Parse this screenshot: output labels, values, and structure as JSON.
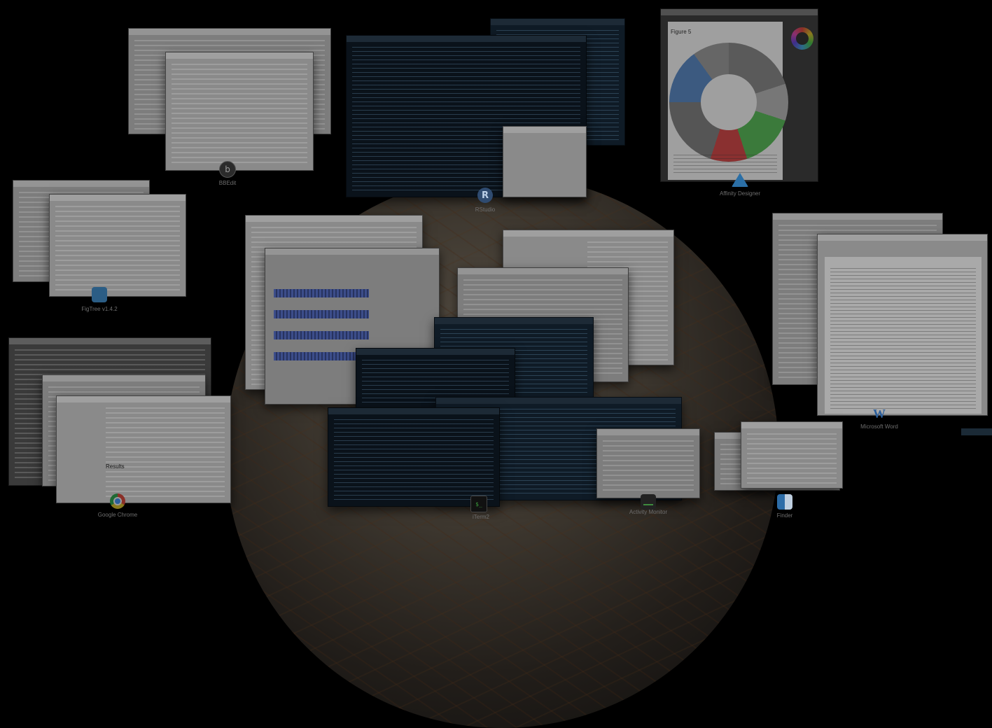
{
  "desktop": {
    "apps": [
      {
        "key": "bbedit",
        "label": "BBEdit"
      },
      {
        "key": "rstudio",
        "label": "RStudio",
        "icon_text": "R"
      },
      {
        "key": "affinity",
        "label": "Affinity Designer"
      },
      {
        "key": "figtree",
        "label": "FigTree v1.4.2"
      },
      {
        "key": "word",
        "label": "Microsoft Word",
        "icon_text": "W"
      },
      {
        "key": "chrome",
        "label": "Google Chrome"
      },
      {
        "key": "iterm",
        "label": "iTerm2"
      },
      {
        "key": "activity",
        "label": "Activity Monitor"
      },
      {
        "key": "finder",
        "label": "Finder"
      }
    ],
    "affinity_doc": {
      "figure_title": "Figure 5"
    },
    "browser_doc": {
      "section_text": "Results"
    }
  },
  "colors": {
    "background": "#000000",
    "terminal": "#0f1b26",
    "window_light": "#7d7d7d",
    "accent_blue": "#2c5f9c"
  }
}
